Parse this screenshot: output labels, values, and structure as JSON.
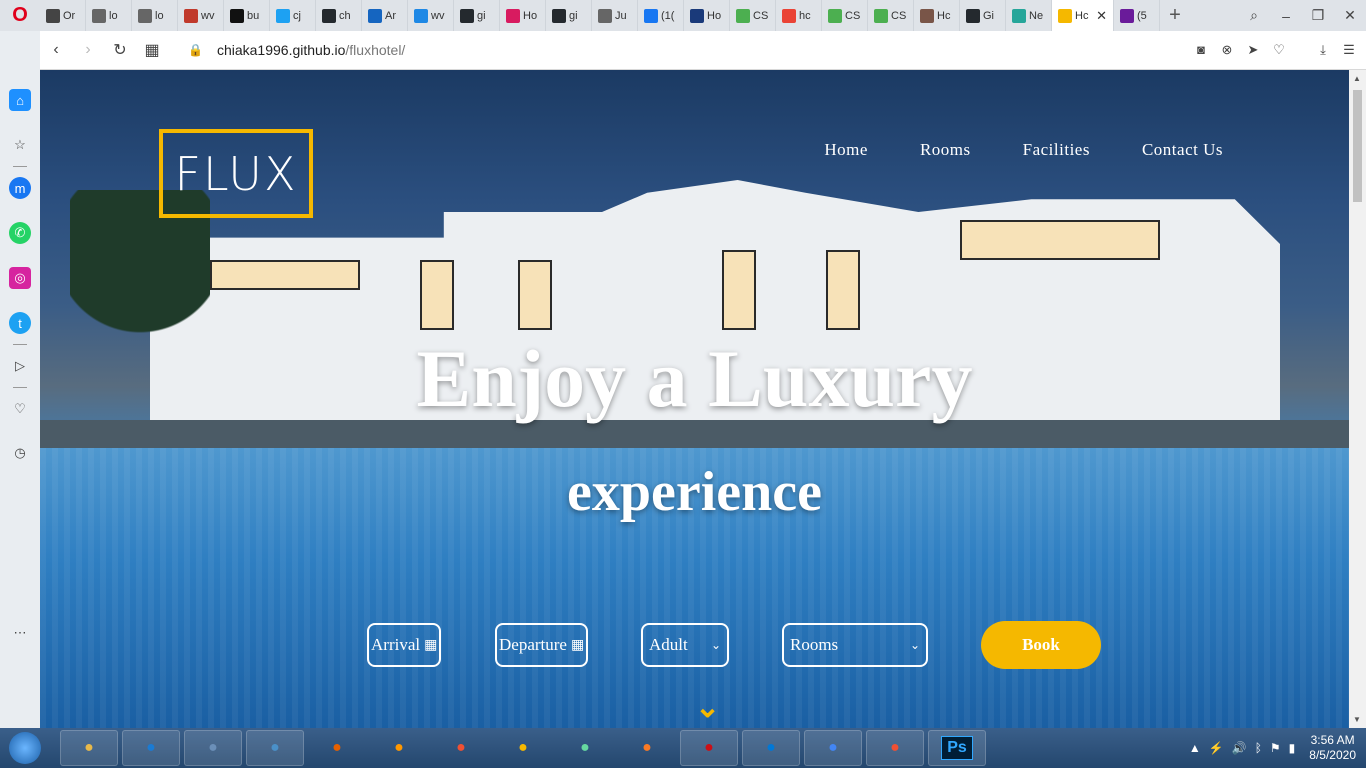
{
  "browser": {
    "tabs": [
      {
        "label": "Or",
        "color": "#444"
      },
      {
        "label": "lo",
        "color": "#666"
      },
      {
        "label": "lo",
        "color": "#666"
      },
      {
        "label": "wv",
        "color": "#c0392b"
      },
      {
        "label": "bu",
        "color": "#111"
      },
      {
        "label": "cj",
        "color": "#1da1f2"
      },
      {
        "label": "ch",
        "color": "#24292e"
      },
      {
        "label": "Ar",
        "color": "#1565c0"
      },
      {
        "label": "wv",
        "color": "#1e88e5"
      },
      {
        "label": "gi",
        "color": "#24292e"
      },
      {
        "label": "Ho",
        "color": "#d81b60"
      },
      {
        "label": "gi",
        "color": "#24292e"
      },
      {
        "label": "Ju",
        "color": "#666"
      },
      {
        "label": "(1(",
        "color": "#1877f2"
      },
      {
        "label": "Ho",
        "color": "#1a3a7a"
      },
      {
        "label": "CS",
        "color": "#4caf50"
      },
      {
        "label": "hc",
        "color": "#ea4335"
      },
      {
        "label": "CS",
        "color": "#4caf50"
      },
      {
        "label": "CS",
        "color": "#4caf50"
      },
      {
        "label": "Hc",
        "color": "#795548"
      },
      {
        "label": "Gi",
        "color": "#24292e"
      },
      {
        "label": "Ne",
        "color": "#26a69a"
      },
      {
        "label": "Hc",
        "color": "#f5b800",
        "active": true
      },
      {
        "label": "(5",
        "color": "#6a1b9a"
      }
    ],
    "url_host": "chiaka1996.github.io",
    "url_path": "/fluxhotel/"
  },
  "sidebar": {
    "colors": {
      "home": "#1e90ff",
      "messenger": "#1877f2",
      "whatsapp": "#25d366",
      "instagram": "#d6249f",
      "twitter": "#1da1f2"
    }
  },
  "site": {
    "logo": "FLUX",
    "nav": [
      "Home",
      "Rooms",
      "Facilities",
      "Contact Us"
    ],
    "hero_line1": "Enjoy a Luxury",
    "hero_line2": "experience",
    "form": {
      "arrival": "Arrival",
      "departure": "Departure",
      "adult": "Adult",
      "rooms": "Rooms",
      "book": "Book"
    },
    "accent": "#f5b800"
  },
  "taskbar": {
    "apps": [
      "Explorer",
      "IE",
      "Keyboard",
      "Media",
      "Firefox",
      "Sublime",
      "Git",
      "Keys",
      "Atom",
      "XAMPP",
      "Opera",
      "VS Code",
      "Chrome",
      "Git GUI",
      "Ps"
    ],
    "time": "3:56 AM",
    "date": "8/5/2020"
  }
}
